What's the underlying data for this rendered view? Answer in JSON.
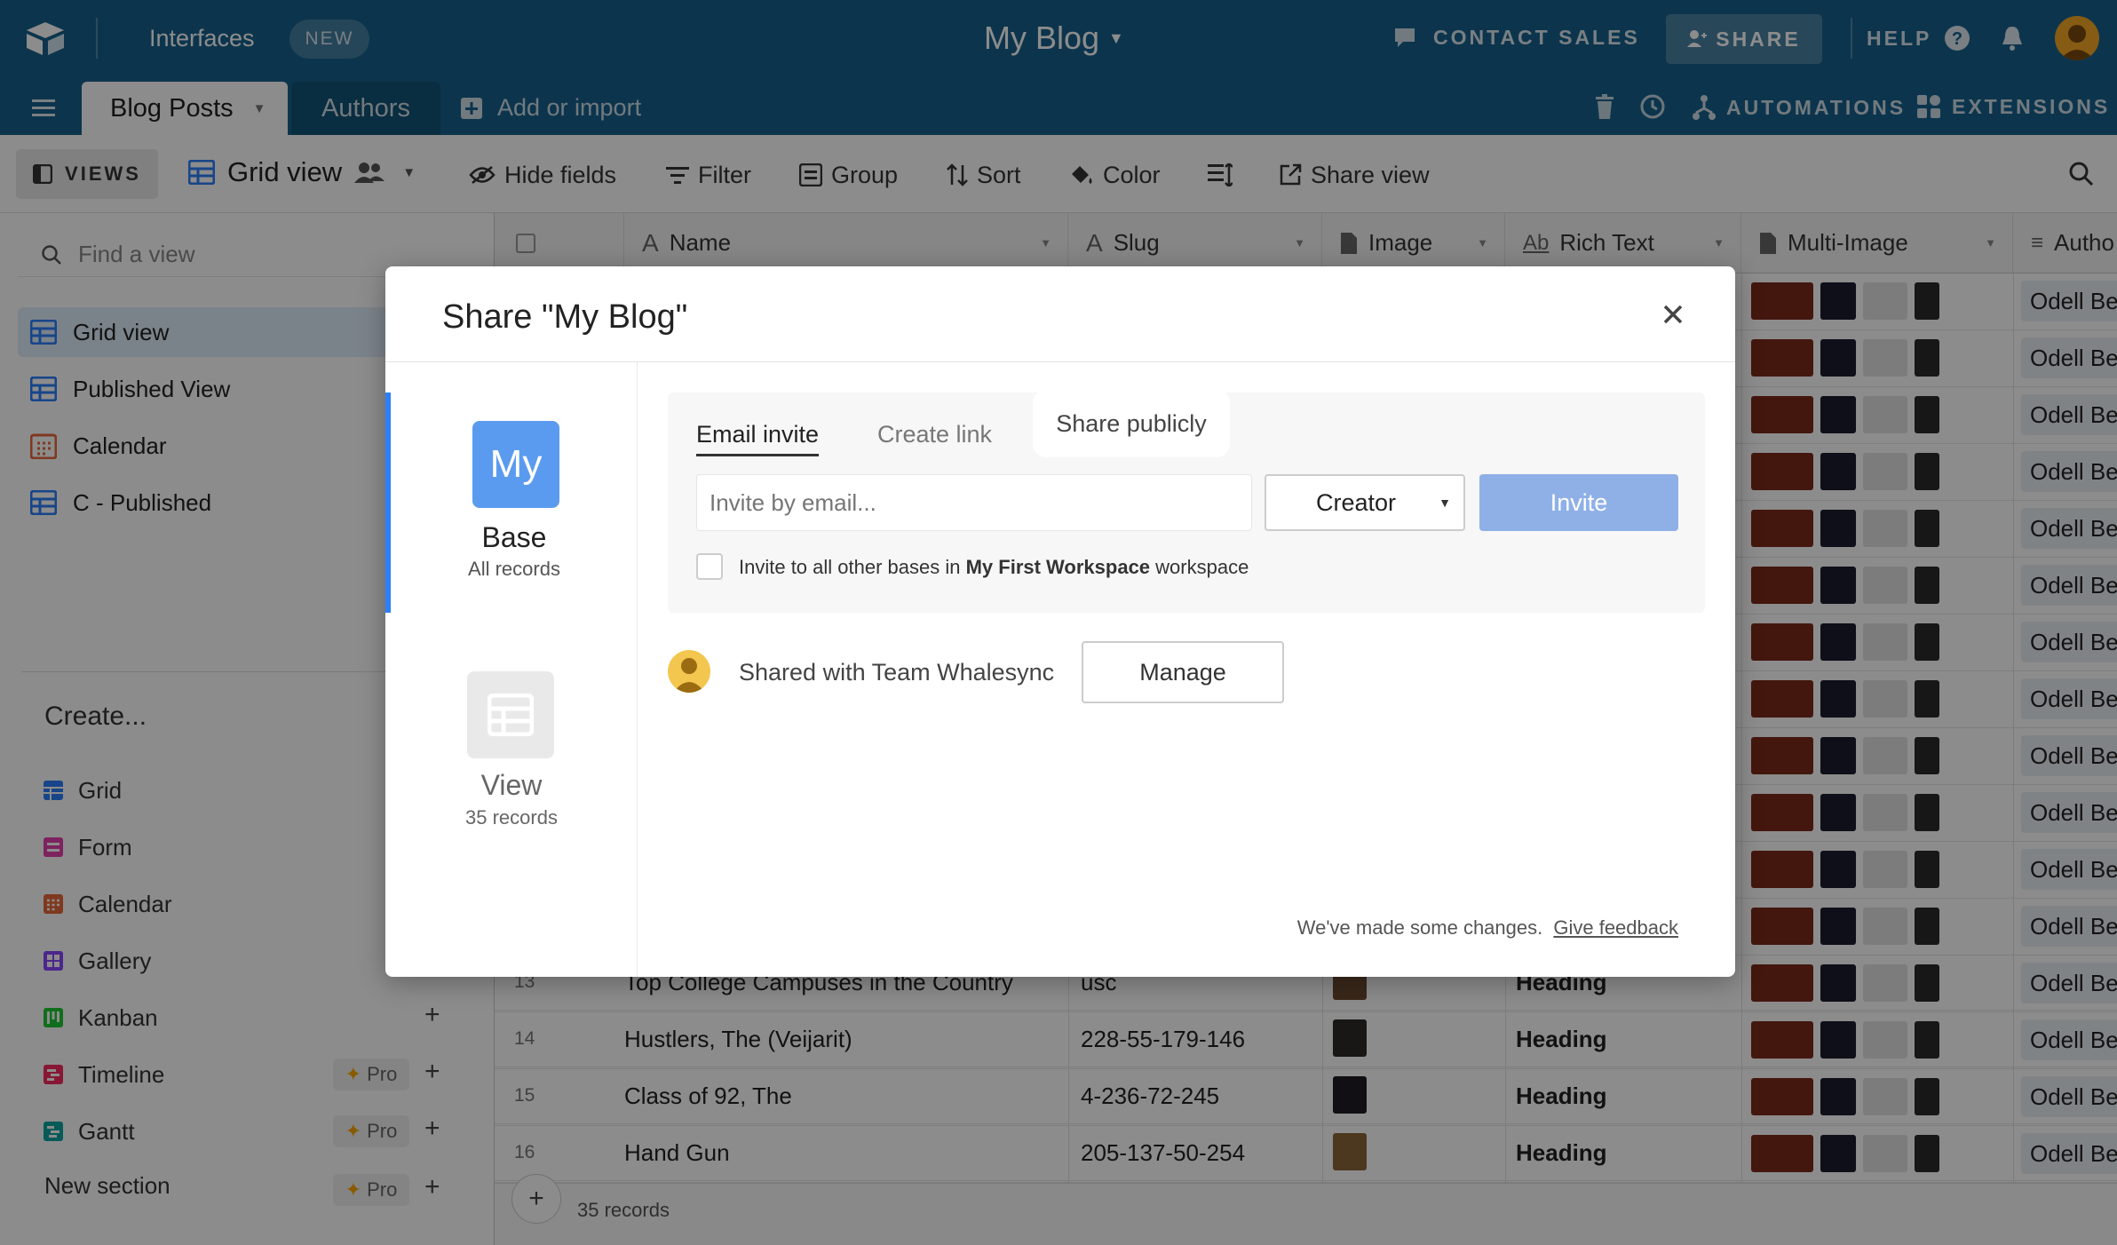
{
  "topbar": {
    "interfaces": "Interfaces",
    "new_badge": "NEW",
    "base_title": "My Blog",
    "contact_sales": "CONTACT SALES",
    "share": "SHARE",
    "help": "HELP"
  },
  "tablebar": {
    "tabs": [
      "Blog Posts",
      "Authors"
    ],
    "add_or_import": "Add or import",
    "automations": "AUTOMATIONS",
    "extensions": "EXTENSIONS"
  },
  "toolbar": {
    "views": "VIEWS",
    "grid_view": "Grid view",
    "hide_fields": "Hide fields",
    "filter": "Filter",
    "group": "Group",
    "sort": "Sort",
    "color": "Color",
    "share_view": "Share view"
  },
  "sidebar": {
    "find_placeholder": "Find a view",
    "views": [
      "Grid view",
      "Published View",
      "Calendar",
      "C - Published"
    ],
    "create_heading": "Create...",
    "create_items": [
      "Grid",
      "Form",
      "Calendar",
      "Gallery",
      "Kanban",
      "Timeline",
      "Gantt"
    ],
    "new_section": "New section",
    "pro_label": "Pro"
  },
  "grid": {
    "columns": [
      "Name",
      "Slug",
      "Image",
      "Rich Text",
      "Multi-Image",
      "Autho"
    ],
    "rows": [
      {
        "num": "13",
        "name": "Top College Campuses in the Country",
        "slug": "usc",
        "rich": "Heading",
        "author": "Odell Be"
      },
      {
        "num": "14",
        "name": "Hustlers, The (Veijarit)",
        "slug": "228-55-179-146",
        "rich": "Heading",
        "author": "Odell Be"
      },
      {
        "num": "15",
        "name": "Class of 92, The",
        "slug": "4-236-72-245",
        "rich": "Heading",
        "author": "Odell Be"
      },
      {
        "num": "16",
        "name": "Hand Gun",
        "slug": "205-137-50-254",
        "rich": "Heading",
        "author": "Odell Be"
      }
    ],
    "author_value": "Odell Be",
    "record_count": "35 records"
  },
  "modal": {
    "title": "Share \"My Blog\"",
    "base_icon": "My",
    "base_label": "Base",
    "base_sub": "All records",
    "view_label": "View",
    "view_sub": "35 records",
    "tabs": [
      "Email invite",
      "Create link",
      "Share publicly"
    ],
    "email_placeholder": "Invite by email...",
    "role": "Creator",
    "invite_button": "Invite",
    "checkbox_pre": "Invite to all other bases in ",
    "checkbox_bold": "My First Workspace",
    "checkbox_post": " workspace",
    "shared_with": "Shared with Team Whalesync",
    "manage": "Manage",
    "footer_text": "We've made some changes.",
    "feedback_link": "Give feedback"
  },
  "colors": {
    "topbar": "#16618c",
    "accent_blue": "#2d7ff9",
    "invite_disabled": "#8fb0e6"
  }
}
